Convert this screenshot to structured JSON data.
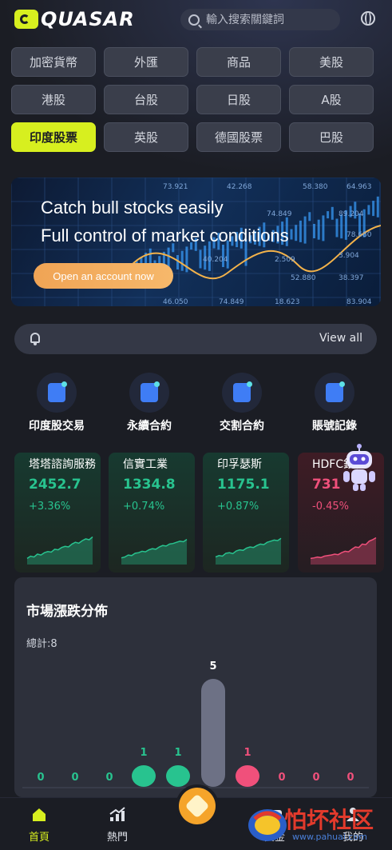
{
  "header": {
    "logo_text": "QUASAR",
    "search_placeholder": "輸入搜索關鍵詞",
    "globe_icon": "globe-icon"
  },
  "markets": [
    {
      "label": "加密貨幣",
      "active": false
    },
    {
      "label": "外匯",
      "active": false
    },
    {
      "label": "商品",
      "active": false
    },
    {
      "label": "美股",
      "active": false
    },
    {
      "label": "港股",
      "active": false
    },
    {
      "label": "台股",
      "active": false
    },
    {
      "label": "日股",
      "active": false
    },
    {
      "label": "A股",
      "active": false
    },
    {
      "label": "印度股票",
      "active": true
    },
    {
      "label": "英股",
      "active": false
    },
    {
      "label": "德國股票",
      "active": false
    },
    {
      "label": "巴股",
      "active": false
    }
  ],
  "banner": {
    "line1": "Catch bull stocks easily",
    "line2": "Full control of market conditions",
    "cta": "Open an account now",
    "tickers": [
      "73.921",
      "42.268",
      "58.380",
      "64.963",
      "74.849",
      "89.204",
      "78.680",
      "3.904",
      "40.204",
      "2.509",
      "38.397",
      "46.050",
      "74.849",
      "18.623",
      "83.904",
      "52.880"
    ]
  },
  "notice": {
    "view_all": "View all"
  },
  "quick_actions": [
    {
      "label": "印度股交易",
      "icon": "chart-bar-icon"
    },
    {
      "label": "永續合約",
      "icon": "wave-chart-icon"
    },
    {
      "label": "交割合約",
      "icon": "dice-icon"
    },
    {
      "label": "賬號記錄",
      "icon": "document-check-icon"
    }
  ],
  "stocks": [
    {
      "name": "塔塔諮詢服務",
      "price": "2452.7",
      "change": "+3.36%",
      "direction": "up",
      "trend": [
        0.1,
        0.18,
        0.15,
        0.25,
        0.22,
        0.3,
        0.34,
        0.32,
        0.42,
        0.4,
        0.48,
        0.52,
        0.5,
        0.6,
        0.66,
        0.63,
        0.72,
        0.78,
        0.75,
        0.85
      ]
    },
    {
      "name": "信實工業",
      "price": "1334.8",
      "change": "+0.74%",
      "direction": "up",
      "trend": [
        0.12,
        0.15,
        0.22,
        0.2,
        0.28,
        0.3,
        0.35,
        0.33,
        0.4,
        0.44,
        0.42,
        0.5,
        0.55,
        0.53,
        0.6,
        0.62,
        0.66,
        0.7,
        0.68,
        0.76
      ]
    },
    {
      "name": "印孚瑟斯",
      "price": "1175.1",
      "change": "+0.87%",
      "direction": "up",
      "trend": [
        0.15,
        0.2,
        0.18,
        0.28,
        0.3,
        0.27,
        0.36,
        0.4,
        0.38,
        0.46,
        0.5,
        0.48,
        0.55,
        0.6,
        0.58,
        0.66,
        0.7,
        0.74,
        0.72,
        0.8
      ]
    },
    {
      "name": "HDFC銀行",
      "price": "731",
      "change": "-0.45%",
      "direction": "down",
      "trend": [
        0.1,
        0.12,
        0.15,
        0.13,
        0.18,
        0.2,
        0.22,
        0.25,
        0.23,
        0.3,
        0.35,
        0.33,
        0.42,
        0.5,
        0.48,
        0.6,
        0.58,
        0.7,
        0.75,
        0.82
      ]
    }
  ],
  "distribution": {
    "title": "市場漲跌分佈",
    "total": "總計:8",
    "chart_data": {
      "type": "bar",
      "values": [
        0,
        0,
        0,
        1,
        1,
        5,
        1,
        0,
        0,
        0
      ],
      "colors": [
        "#28c38f",
        "#28c38f",
        "#28c38f",
        "#28c38f",
        "#28c38f",
        "#6d7185",
        "#f0507b",
        "#f0507b",
        "#f0507b",
        "#f0507b"
      ]
    }
  },
  "nav": [
    {
      "label": "首頁",
      "icon": "home-icon",
      "active": true
    },
    {
      "label": "熱門",
      "icon": "trend-icon",
      "active": false
    },
    {
      "label": "資金",
      "icon": "wallet-icon",
      "active": false
    },
    {
      "label": "我的",
      "icon": "user-icon",
      "active": false
    }
  ],
  "watermark": {
    "text": "怕坏社区",
    "url": "www.pahuai.com"
  },
  "colors": {
    "accent": "#d7ef1f",
    "up": "#28c38f",
    "down": "#f0507b",
    "flat": "#6d7185",
    "background": "#1b1d24"
  }
}
